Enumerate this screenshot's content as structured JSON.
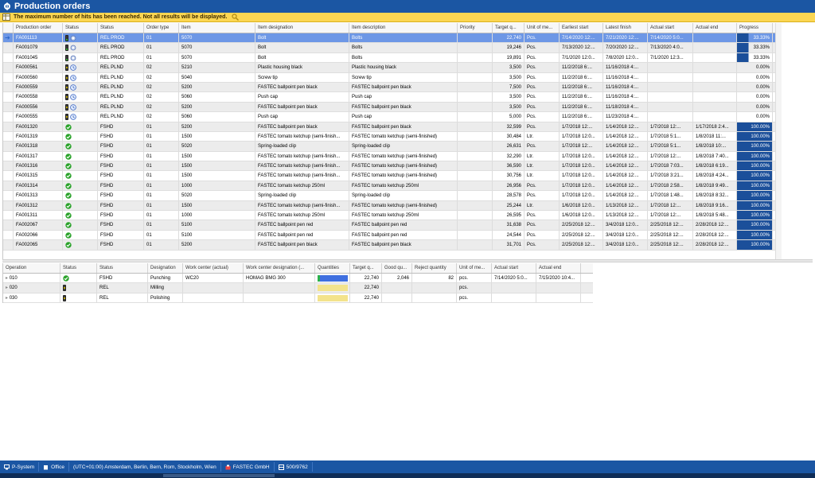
{
  "window": {
    "title": "Production orders"
  },
  "warning": {
    "text": "The maximum number of hits has been reached. Not all results will be displayed."
  },
  "colors": {
    "titlebar": "#1b56a3",
    "warning": "#fbd652",
    "selection": "#6d97e6",
    "progress": "#1b4f9a"
  },
  "orders": {
    "columns": [
      {
        "key": "order",
        "label": "Production order",
        "w": 62
      },
      {
        "key": "status_icon",
        "label": "Status",
        "w": 44
      },
      {
        "key": "status",
        "label": "Status",
        "w": 58
      },
      {
        "key": "type",
        "label": "Order type",
        "w": 44
      },
      {
        "key": "item",
        "label": "Item",
        "w": 96
      },
      {
        "key": "designation",
        "label": "Item designation",
        "w": 118
      },
      {
        "key": "description",
        "label": "Item description",
        "w": 136
      },
      {
        "key": "priority",
        "label": "Priority",
        "w": 44
      },
      {
        "key": "target",
        "label": "Target q...",
        "w": 40
      },
      {
        "key": "unit",
        "label": "Unit of me...",
        "w": 44
      },
      {
        "key": "earliest",
        "label": "Earliest start",
        "w": 55
      },
      {
        "key": "latest",
        "label": "Latest finish",
        "w": 56
      },
      {
        "key": "astart",
        "label": "Actual start",
        "w": 57
      },
      {
        "key": "aend",
        "label": "Actual end",
        "w": 55
      },
      {
        "key": "progress",
        "label": "Progress",
        "w": 45
      }
    ],
    "rows": [
      {
        "order": "FA001113",
        "icon": "yellow-gear",
        "status": "REL PROD",
        "type": "01",
        "item": "5070",
        "designation": "Bolt",
        "description": "Bolts",
        "target": "22,740",
        "unit": "Pcs.",
        "earliest": "7/14/2020 12:...",
        "latest": "7/21/2020 12:...",
        "astart": "7/14/2020 5:0...",
        "aend": "",
        "progress": "33.33%",
        "pct": 33,
        "selected": true
      },
      {
        "order": "FA001079",
        "icon": "yellow-gear",
        "status": "REL PROD",
        "type": "01",
        "item": "5070",
        "designation": "Bolt",
        "description": "Bolts",
        "target": "19,246",
        "unit": "Pcs.",
        "earliest": "7/13/2020 12:...",
        "latest": "7/20/2020 12:...",
        "astart": "7/13/2020 4:0...",
        "aend": "",
        "progress": "33.33%",
        "pct": 33
      },
      {
        "order": "FA001045",
        "icon": "yellow-gear",
        "status": "REL PROD",
        "type": "01",
        "item": "5070",
        "designation": "Bolt",
        "description": "Bolts",
        "target": "19,891",
        "unit": "Pcs.",
        "earliest": "7/1/2020 12:0...",
        "latest": "7/8/2020 12:0...",
        "astart": "7/1/2020 12:3...",
        "aend": "",
        "progress": "33.33%",
        "pct": 33
      },
      {
        "order": "FA000561",
        "icon": "yellow-clock",
        "status": "REL PLND",
        "type": "02",
        "item": "5210",
        "designation": "Plastic housing black",
        "description": "Plastic housing black",
        "target": "3,500",
        "unit": "Pcs.",
        "earliest": "11/2/2018 6:...",
        "latest": "11/16/2018 4:...",
        "astart": "",
        "aend": "",
        "progress": "0.00%",
        "pct": 0
      },
      {
        "order": "FA000560",
        "icon": "yellow-clock",
        "status": "REL PLND",
        "type": "02",
        "item": "5040",
        "designation": "Screw tip",
        "description": "Screw tip",
        "target": "3,500",
        "unit": "Pcs.",
        "earliest": "11/2/2018 6:...",
        "latest": "11/16/2018 4:...",
        "astart": "",
        "aend": "",
        "progress": "0.00%",
        "pct": 0
      },
      {
        "order": "FA000559",
        "icon": "yellow-clock",
        "status": "REL PLND",
        "type": "02",
        "item": "5200",
        "designation": "FASTEC ballpoint pen black",
        "description": "FASTEC ballpoint pen black",
        "target": "7,500",
        "unit": "Pcs.",
        "earliest": "11/2/2018 6:...",
        "latest": "11/16/2018 4:...",
        "astart": "",
        "aend": "",
        "progress": "0.00%",
        "pct": 0
      },
      {
        "order": "FA000558",
        "icon": "yellow-clock",
        "status": "REL PLND",
        "type": "02",
        "item": "5060",
        "designation": "Push cap",
        "description": "Push cap",
        "target": "3,500",
        "unit": "Pcs.",
        "earliest": "11/2/2018 6:...",
        "latest": "11/16/2018 4:...",
        "astart": "",
        "aend": "",
        "progress": "0.00%",
        "pct": 0
      },
      {
        "order": "FA000556",
        "icon": "yellow-clock",
        "status": "REL PLND",
        "type": "02",
        "item": "5200",
        "designation": "FASTEC ballpoint pen black",
        "description": "FASTEC ballpoint pen black",
        "target": "3,500",
        "unit": "Pcs.",
        "earliest": "11/2/2018 6:...",
        "latest": "11/18/2018 4:...",
        "astart": "",
        "aend": "",
        "progress": "0.00%",
        "pct": 0
      },
      {
        "order": "FA000555",
        "icon": "yellow-clock",
        "status": "REL PLND",
        "type": "02",
        "item": "5060",
        "designation": "Push cap",
        "description": "Push cap",
        "target": "5,000",
        "unit": "Pcs.",
        "earliest": "11/2/2018 6:...",
        "latest": "11/23/2018 4:...",
        "astart": "",
        "aend": "",
        "progress": "0.00%",
        "pct": 0
      },
      {
        "order": "FA001320",
        "icon": "check",
        "status": "FSHD",
        "type": "01",
        "item": "5200",
        "designation": "FASTEC ballpoint pen black",
        "description": "FASTEC ballpoint pen black",
        "target": "32,599",
        "unit": "Pcs.",
        "earliest": "1/7/2018 12:...",
        "latest": "1/14/2018 12:...",
        "astart": "1/7/2018 12:...",
        "aend": "1/17/2018 2:4...",
        "progress": "100.00%",
        "pct": 100
      },
      {
        "order": "FA001319",
        "icon": "check",
        "status": "FSHD",
        "type": "01",
        "item": "1500",
        "designation": "FASTEC tomato ketchup (semi-finish...",
        "description": "FASTEC tomato ketchup (semi-finished)",
        "target": "30,484",
        "unit": "Ltr.",
        "earliest": "1/7/2018 12:0...",
        "latest": "1/14/2018 12:...",
        "astart": "1/7/2018 5:1...",
        "aend": "1/8/2018 11:...",
        "progress": "100.00%",
        "pct": 100
      },
      {
        "order": "FA001318",
        "icon": "check",
        "status": "FSHD",
        "type": "01",
        "item": "5020",
        "designation": "Spring-loaded clip",
        "description": "Spring-loaded clip",
        "target": "26,631",
        "unit": "Pcs.",
        "earliest": "1/7/2018 12:...",
        "latest": "1/14/2018 12:...",
        "astart": "1/7/2018 5:1...",
        "aend": "1/8/2018 10:...",
        "progress": "100.00%",
        "pct": 100
      },
      {
        "order": "FA001317",
        "icon": "check",
        "status": "FSHD",
        "type": "01",
        "item": "1500",
        "designation": "FASTEC tomato ketchup (semi-finish...",
        "description": "FASTEC tomato ketchup (semi-finished)",
        "target": "32,290",
        "unit": "Ltr.",
        "earliest": "1/7/2018 12:0...",
        "latest": "1/14/2018 12:...",
        "astart": "1/7/2018 12:...",
        "aend": "1/8/2018 7:40...",
        "progress": "100.00%",
        "pct": 100
      },
      {
        "order": "FA001316",
        "icon": "check",
        "status": "FSHD",
        "type": "01",
        "item": "1500",
        "designation": "FASTEC tomato ketchup (semi-finish...",
        "description": "FASTEC tomato ketchup (semi-finished)",
        "target": "36,590",
        "unit": "Ltr.",
        "earliest": "1/7/2018 12:0...",
        "latest": "1/14/2018 12:...",
        "astart": "1/7/2018 7:03...",
        "aend": "1/8/2018 6:19...",
        "progress": "100.00%",
        "pct": 100
      },
      {
        "order": "FA001315",
        "icon": "check",
        "status": "FSHD",
        "type": "01",
        "item": "1500",
        "designation": "FASTEC tomato ketchup (semi-finish...",
        "description": "FASTEC tomato ketchup (semi-finished)",
        "target": "30,756",
        "unit": "Ltr.",
        "earliest": "1/7/2018 12:0...",
        "latest": "1/14/2018 12:...",
        "astart": "1/7/2018 3:21...",
        "aend": "1/8/2018 4:24...",
        "progress": "100.00%",
        "pct": 100
      },
      {
        "order": "FA001314",
        "icon": "check",
        "status": "FSHD",
        "type": "01",
        "item": "1000",
        "designation": "FASTEC tomato ketchup 250ml",
        "description": "FASTEC tomato ketchup 250ml",
        "target": "26,956",
        "unit": "Pcs.",
        "earliest": "1/7/2018 12:0...",
        "latest": "1/14/2018 12:...",
        "astart": "1/7/2018 2:58...",
        "aend": "1/8/2018 9:49...",
        "progress": "100.00%",
        "pct": 100
      },
      {
        "order": "FA001313",
        "icon": "check",
        "status": "FSHD",
        "type": "01",
        "item": "5020",
        "designation": "Spring-loaded clip",
        "description": "Spring-loaded clip",
        "target": "28,578",
        "unit": "Pcs.",
        "earliest": "1/7/2018 12:0...",
        "latest": "1/14/2018 12:...",
        "astart": "1/7/2018 1:48...",
        "aend": "1/8/2018 8:32...",
        "progress": "100.00%",
        "pct": 100
      },
      {
        "order": "FA001312",
        "icon": "check",
        "status": "FSHD",
        "type": "01",
        "item": "1500",
        "designation": "FASTEC tomato ketchup (semi-finish...",
        "description": "FASTEC tomato ketchup (semi-finished)",
        "target": "25,244",
        "unit": "Ltr.",
        "earliest": "1/6/2018 12:0...",
        "latest": "1/13/2018 12:...",
        "astart": "1/7/2018 12:...",
        "aend": "1/8/2018 9:16...",
        "progress": "100.00%",
        "pct": 100
      },
      {
        "order": "FA001311",
        "icon": "check",
        "status": "FSHD",
        "type": "01",
        "item": "1000",
        "designation": "FASTEC tomato ketchup 250ml",
        "description": "FASTEC tomato ketchup 250ml",
        "target": "26,595",
        "unit": "Pcs.",
        "earliest": "1/6/2018 12:0...",
        "latest": "1/13/2018 12:...",
        "astart": "1/7/2018 12:...",
        "aend": "1/8/2018 5:48...",
        "progress": "100.00%",
        "pct": 100
      },
      {
        "order": "FA002067",
        "icon": "check",
        "status": "FSHD",
        "type": "01",
        "item": "5100",
        "designation": "FASTEC ballpoint pen red",
        "description": "FASTEC ballpoint pen red",
        "target": "31,638",
        "unit": "Pcs.",
        "earliest": "2/25/2018 12:...",
        "latest": "3/4/2018 12:0...",
        "astart": "2/25/2018 12:...",
        "aend": "2/28/2018 12:...",
        "progress": "100.00%",
        "pct": 100
      },
      {
        "order": "FA002066",
        "icon": "check",
        "status": "FSHD",
        "type": "01",
        "item": "5100",
        "designation": "FASTEC ballpoint pen red",
        "description": "FASTEC ballpoint pen red",
        "target": "24,544",
        "unit": "Pcs.",
        "earliest": "2/25/2018 12:...",
        "latest": "3/4/2018 12:0...",
        "astart": "2/25/2018 12:...",
        "aend": "2/28/2018 12:...",
        "progress": "100.00%",
        "pct": 100
      },
      {
        "order": "FA002065",
        "icon": "check",
        "status": "FSHD",
        "type": "01",
        "item": "5200",
        "designation": "FASTEC ballpoint pen black",
        "description": "FASTEC ballpoint pen black",
        "target": "31,701",
        "unit": "Pcs.",
        "earliest": "2/25/2018 12:...",
        "latest": "3/4/2018 12:0...",
        "astart": "2/25/2018 12:...",
        "aend": "2/28/2018 12:...",
        "progress": "100.00%",
        "pct": 100
      }
    ]
  },
  "operations": {
    "columns": [
      {
        "key": "op",
        "label": "Operation",
        "w": 72
      },
      {
        "key": "icon",
        "label": "Status",
        "w": 46
      },
      {
        "key": "status",
        "label": "Status",
        "w": 64
      },
      {
        "key": "designation",
        "label": "Designation",
        "w": 44
      },
      {
        "key": "wc",
        "label": "Work center (actual)",
        "w": 76
      },
      {
        "key": "wcd",
        "label": "Work center designation (...",
        "w": 90
      },
      {
        "key": "qty",
        "label": "Quantities",
        "w": 44
      },
      {
        "key": "target",
        "label": "Target q...",
        "w": 40
      },
      {
        "key": "good",
        "label": "Good qu...",
        "w": 38
      },
      {
        "key": "reject",
        "label": "Reject quantity",
        "w": 56
      },
      {
        "key": "unit",
        "label": "Unit of me...",
        "w": 44
      },
      {
        "key": "astart",
        "label": "Actual start",
        "w": 56
      },
      {
        "key": "aend",
        "label": "Actual end",
        "w": 56
      }
    ],
    "rows": [
      {
        "op": "010",
        "icon": "check",
        "status": "FSHD",
        "designation": "Punching",
        "wc": "WC20",
        "wcd": "HOMAG BMG 300",
        "active": true,
        "target": "22,740",
        "good": "2,046",
        "reject": "82",
        "unit": "pcs.",
        "astart": "7/14/2020 5:0...",
        "aend": "7/15/2020 10:4..."
      },
      {
        "op": "020",
        "icon": "traffic",
        "status": "REL",
        "designation": "Milling",
        "wc": "",
        "wcd": "",
        "active": false,
        "target": "22,740",
        "good": "",
        "reject": "",
        "unit": "pcs.",
        "astart": "",
        "aend": ""
      },
      {
        "op": "030",
        "icon": "traffic",
        "status": "REL",
        "designation": "Polishing",
        "wc": "",
        "wcd": "",
        "active": false,
        "target": "22,740",
        "good": "",
        "reject": "",
        "unit": "pcs.",
        "astart": "",
        "aend": ""
      }
    ]
  },
  "statusbar": {
    "system": "P-System",
    "office": "Office",
    "timezone": "(UTC+01:00) Amsterdam, Berlin, Bern, Rom, Stockholm, Wien",
    "company": "FASTEC GmbH",
    "count": "500/9762"
  }
}
